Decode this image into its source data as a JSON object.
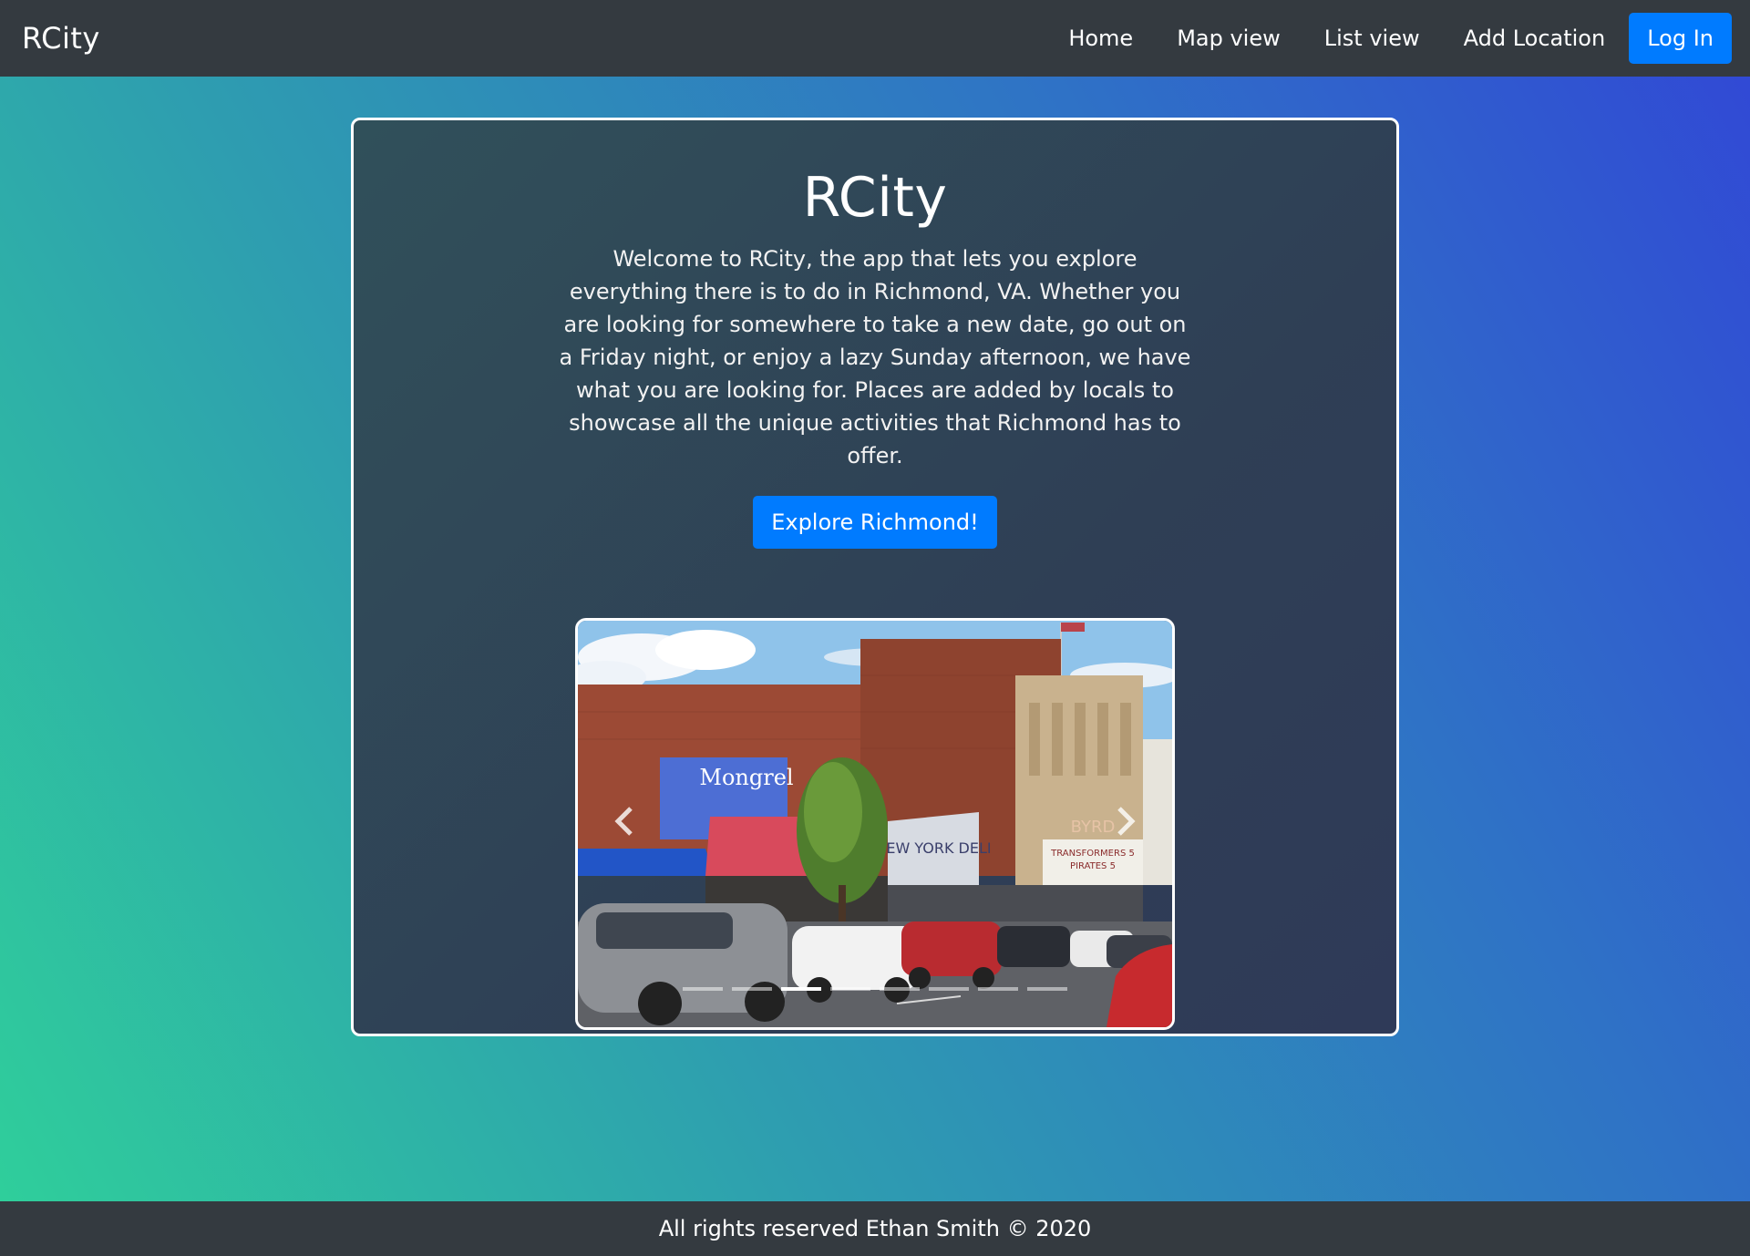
{
  "navbar": {
    "brand": "RCity",
    "links": [
      "Home",
      "Map view",
      "List view",
      "Add Location"
    ],
    "login_label": "Log In"
  },
  "hero": {
    "title": "RCity",
    "intro": "Welcome to RCity, the app that lets you explore everything there is to do in Richmond, VA. Whether you are looking for somewhere to take a new date, go out on a Friday night, or enjoy a lazy Sunday afternoon, we have what you are looking for. Places are added by locals to showcase all the unique activities that Richmond has to offer.",
    "cta_label": "Explore Richmond!"
  },
  "carousel": {
    "slide_count": 8,
    "active_index": 2,
    "prev_icon": "chevron-left-icon",
    "next_icon": "chevron-right-icon",
    "storefront_signs": [
      "Mongrel",
      "NEW YORK DELI",
      "BYRD",
      "TRANSFORMERS 5",
      "PIRATES 5"
    ]
  },
  "footer": {
    "text": "All rights reserved Ethan Smith © 2020"
  },
  "colors": {
    "navbar_bg": "#343a40",
    "primary_button": "#007bff",
    "gradient_start": "#2fd09a",
    "gradient_end": "#3147d6"
  }
}
